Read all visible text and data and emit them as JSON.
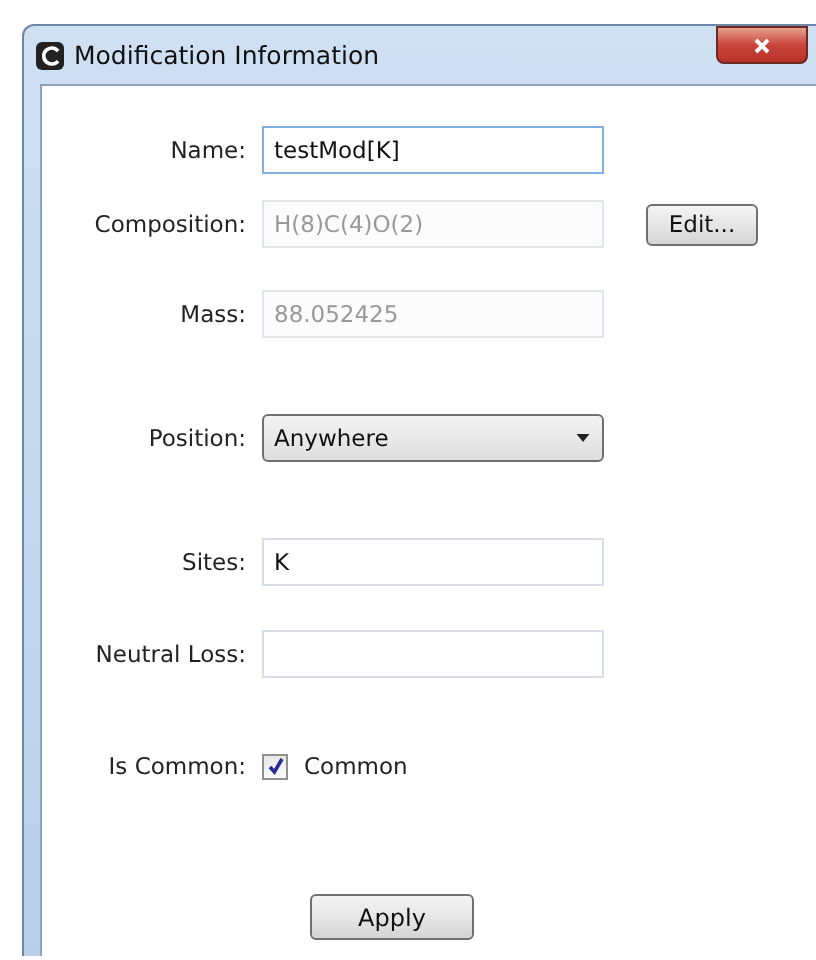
{
  "window": {
    "title": "Modification Information"
  },
  "fields": [
    {
      "kind": "text",
      "label": "Name:",
      "value": "testMod[K]",
      "disabled": false,
      "focused": true
    },
    {
      "kind": "text",
      "label": "Composition:",
      "value": "H(8)C(4)O(2)",
      "disabled": true,
      "focused": false,
      "button": "Edit..."
    },
    {
      "kind": "text",
      "label": "Mass:",
      "value": "88.052425",
      "disabled": true,
      "focused": false
    },
    {
      "kind": "combo",
      "label": "Position:",
      "value": "Anywhere"
    },
    {
      "kind": "text",
      "label": "Sites:",
      "value": "K",
      "disabled": false,
      "focused": false
    },
    {
      "kind": "text",
      "label": "Neutral Loss:",
      "disabled": false,
      "focused": false
    },
    {
      "kind": "check",
      "label": "Is Common:",
      "text": "Common",
      "checked": true
    }
  ],
  "buttons": [
    "Apply"
  ]
}
